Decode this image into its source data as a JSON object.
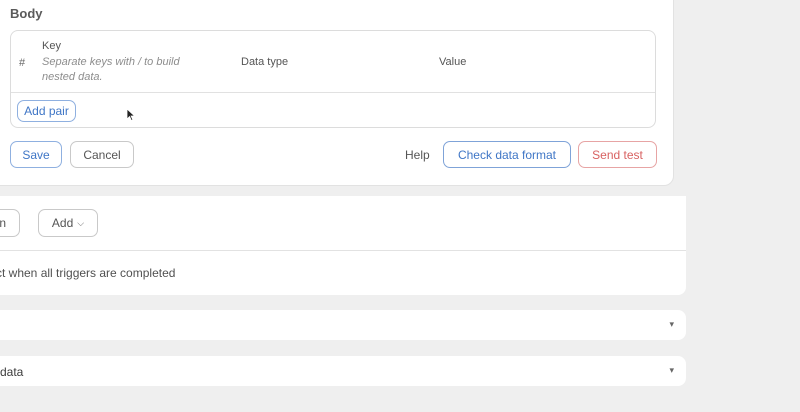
{
  "body_section": {
    "title": "Body",
    "table": {
      "col_index": "#",
      "col_key": "Key",
      "col_key_hint": "Separate keys with / to build nested data.",
      "col_type": "Data type",
      "col_value": "Value"
    },
    "add_pair_label": "Add pair"
  },
  "actions": {
    "save_label": "Save",
    "cancel_label": "Cancel",
    "help_label": "Help",
    "check_format_label": "Check data format",
    "send_test_label": "Send test"
  },
  "conditions": {
    "option_button_label": "ion",
    "add_button_label": "Add",
    "trigger_text": "ct when all triggers are completed"
  },
  "collapsed_rows": [
    {
      "label": ""
    },
    {
      "label": "data"
    }
  ],
  "icons": {
    "chevron": "▾",
    "add_chevron": "⌵"
  },
  "colors": {
    "primary": "#3f76c6",
    "danger": "#d86161",
    "background": "#efefef"
  }
}
